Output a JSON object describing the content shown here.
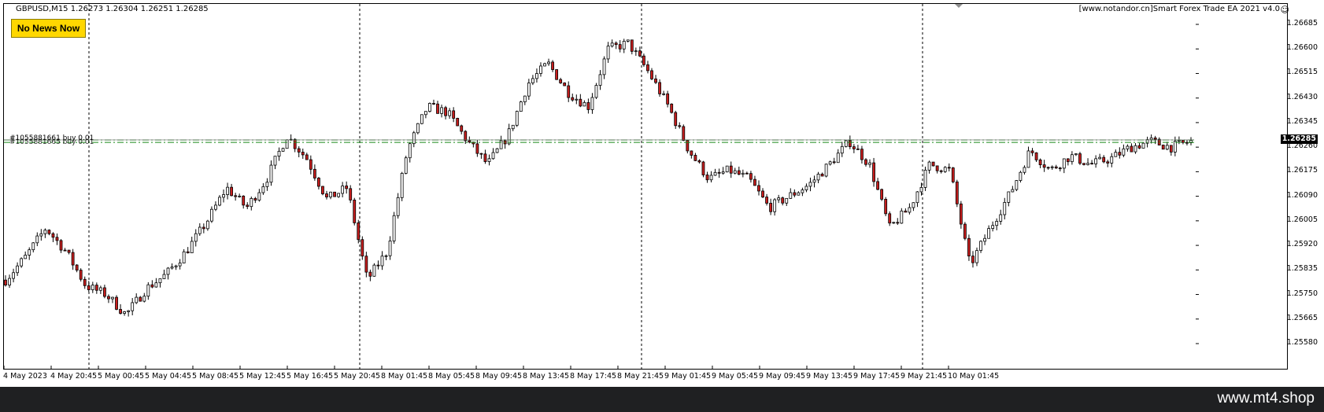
{
  "header": {
    "symbol_title": "GBPUSD,M15  1.26273 1.26304 1.26251 1.26285",
    "ea_title": "[www.notandor.cn]Smart Forex Trade EA 2021 v4.0",
    "smiley_icon": "smiley-icon"
  },
  "news_button": {
    "label": "No News Now",
    "bg": "#ffd700"
  },
  "orders": [
    {
      "label": "#1055881661 buy 0.01",
      "price": 1.26285
    },
    {
      "label": "#1055881665 buy 0.01",
      "price": 1.26282
    }
  ],
  "current_price": "1.26285",
  "footer": {
    "url": "www.mt4.shop"
  },
  "colors": {
    "candle": "#000000",
    "bear_body": "#c81e1e",
    "order_line": "#1a8a1a",
    "grid": "#000000"
  },
  "chart_data": {
    "type": "candlestick",
    "symbol": "GBPUSD",
    "timeframe": "M15",
    "y_ticks": [
      "1.26685",
      "1.26600",
      "1.26515",
      "1.26430",
      "1.26345",
      "1.26260",
      "1.26175",
      "1.26090",
      "1.26005",
      "1.25920",
      "1.25835",
      "1.25750",
      "1.25665",
      "1.25580"
    ],
    "ylim": [
      1.2557,
      1.2672
    ],
    "x_ticks": [
      "4 May 2023",
      "4 May 20:45",
      "5 May 00:45",
      "5 May 04:45",
      "5 May 08:45",
      "5 May 12:45",
      "5 May 16:45",
      "5 May 20:45",
      "8 May 01:45",
      "8 May 05:45",
      "8 May 09:45",
      "8 May 13:45",
      "8 May 17:45",
      "8 May 21:45",
      "9 May 01:45",
      "9 May 05:45",
      "9 May 09:45",
      "9 May 13:45",
      "9 May 17:45",
      "9 May 21:45",
      "10 May 01:45"
    ],
    "period_separators": [
      1,
      7,
      13,
      19
    ],
    "close_path": [
      [
        0,
        1.258
      ],
      [
        1,
        1.2588
      ],
      [
        2,
        1.2598
      ],
      [
        3,
        1.259
      ],
      [
        4,
        1.2578
      ],
      [
        5,
        1.2575
      ],
      [
        6,
        1.2568
      ],
      [
        7,
        1.2577
      ],
      [
        8,
        1.2582
      ],
      [
        9,
        1.259
      ],
      [
        10,
        1.26
      ],
      [
        11,
        1.2612
      ],
      [
        12,
        1.2605
      ],
      [
        13,
        1.2615
      ],
      [
        14,
        1.263
      ],
      [
        15,
        1.2622
      ],
      [
        16,
        1.2608
      ],
      [
        17,
        1.2612
      ],
      [
        18,
        1.258
      ],
      [
        19,
        1.259
      ],
      [
        20,
        1.2625
      ],
      [
        21,
        1.264
      ],
      [
        22,
        1.2638
      ],
      [
        23,
        1.2628
      ],
      [
        24,
        1.262
      ],
      [
        25,
        1.263
      ],
      [
        26,
        1.2648
      ],
      [
        27,
        1.2655
      ],
      [
        28,
        1.2645
      ],
      [
        29,
        1.264
      ],
      [
        30,
        1.266
      ],
      [
        31,
        1.2662
      ],
      [
        32,
        1.2652
      ],
      [
        33,
        1.264
      ],
      [
        34,
        1.2625
      ],
      [
        35,
        1.2615
      ],
      [
        36,
        1.2618
      ],
      [
        37,
        1.2615
      ],
      [
        38,
        1.2605
      ],
      [
        39,
        1.2609
      ],
      [
        40,
        1.2613
      ],
      [
        41,
        1.262
      ],
      [
        42,
        1.2628
      ],
      [
        43,
        1.262
      ],
      [
        44,
        1.2598
      ],
      [
        45,
        1.2605
      ],
      [
        46,
        1.262
      ],
      [
        47,
        1.2618
      ],
      [
        48,
        1.2585
      ],
      [
        49,
        1.2598
      ],
      [
        50,
        1.261
      ],
      [
        51,
        1.2625
      ],
      [
        52,
        1.2618
      ],
      [
        53,
        1.2623
      ],
      [
        54,
        1.262
      ],
      [
        55,
        1.2622
      ],
      [
        56,
        1.2626
      ],
      [
        57,
        1.2628
      ],
      [
        58,
        1.2626
      ],
      [
        59,
        1.2628
      ]
    ]
  }
}
